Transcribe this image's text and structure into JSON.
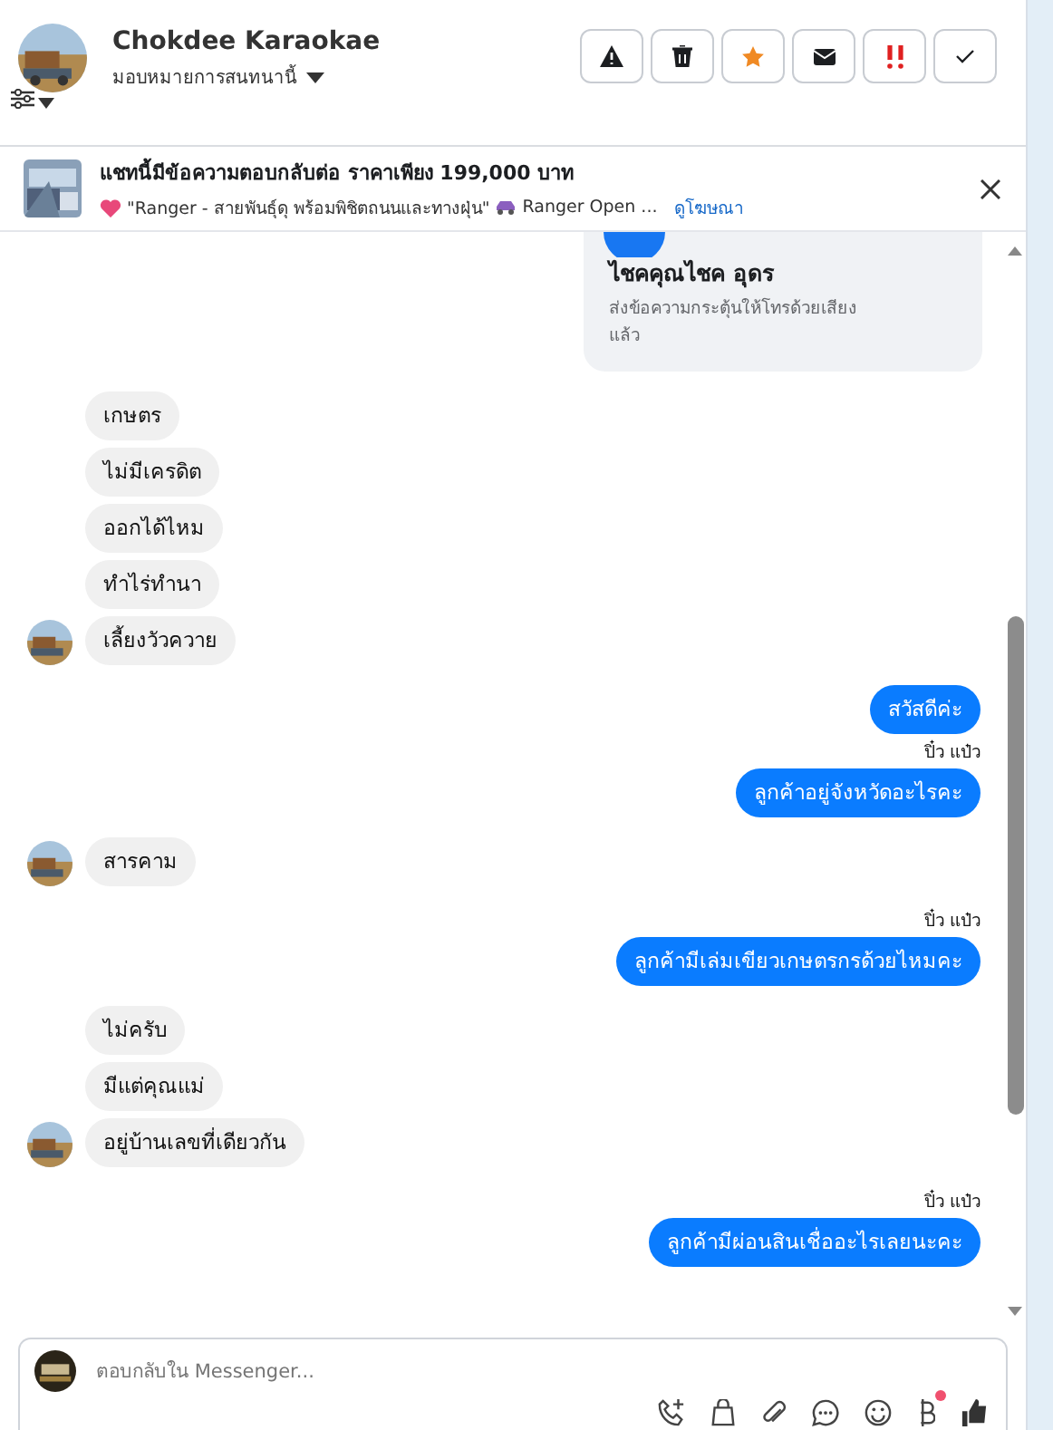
{
  "header": {
    "name": "Chokdee Karaokae",
    "assign": "มอบหมายการสนทนานี้",
    "actions": [
      {
        "kind": "alert"
      },
      {
        "kind": "trash"
      },
      {
        "kind": "star"
      },
      {
        "kind": "mail"
      },
      {
        "kind": "urgent"
      },
      {
        "kind": "check"
      }
    ]
  },
  "ad": {
    "title": "แชทนี้มีข้อความตอบกลับต่อ ราคาเพียง 199,000 บาท",
    "subtitle": "\"Ranger - สายพันธุ์ดุ พร้อมพิชิตถนนและทางฝุ่น\"",
    "subtitle2": "Ranger Open ...",
    "link": "ดูโฆษณา"
  },
  "notice": {
    "title": "ไชคคุณไชค อุดร",
    "text": "ส่งข้อความกระตุ้นให้โทรด้วยเสียงแล้ว"
  },
  "messages": [
    {
      "kind": "incoming",
      "text": "เกษตร",
      "avatar": false
    },
    {
      "kind": "incoming",
      "text": "ไม่มีเครดิต",
      "avatar": false
    },
    {
      "kind": "incoming",
      "text": "ออกได้ไหม",
      "avatar": false
    },
    {
      "kind": "incoming",
      "text": "ทำไร่ทำนา",
      "avatar": false
    },
    {
      "kind": "incoming",
      "text": "เลี้ยงวัวควาย",
      "avatar": true
    },
    {
      "kind": "outgoing",
      "text": "สวัสดีค่ะ"
    },
    {
      "kind": "sender",
      "text": "ปิ๋ว แป๋ว"
    },
    {
      "kind": "outgoing",
      "text": "ลูกค้าอยู่จังหวัดอะไรคะ"
    },
    {
      "kind": "incoming",
      "text": "สารคาม",
      "avatar": true
    },
    {
      "kind": "sender",
      "text": "ปิ๋ว แป๋ว"
    },
    {
      "kind": "outgoing",
      "text": "ลูกค้ามีเล่มเขียวเกษตรกรด้วยไหมคะ"
    },
    {
      "kind": "incoming",
      "text": "ไม่ครับ",
      "avatar": false
    },
    {
      "kind": "incoming",
      "text": "มีแต่คุณแม่",
      "avatar": false
    },
    {
      "kind": "incoming",
      "text": "อยู่บ้านเลขที่เดียวกัน",
      "avatar": true
    },
    {
      "kind": "sender",
      "text": "ปิ๋ว แป๋ว"
    },
    {
      "kind": "outgoing",
      "text": "ลูกค้ามีผ่อนสินเชื่ออะไรเลยนะคะ"
    }
  ],
  "composer": {
    "placeholder": "ตอบกลับใน Messenger...",
    "tools": [
      {
        "kind": "call"
      },
      {
        "kind": "bag"
      },
      {
        "kind": "clip"
      },
      {
        "kind": "chat"
      },
      {
        "kind": "emoji"
      },
      {
        "kind": "baht",
        "badge": true
      },
      {
        "kind": "like"
      }
    ]
  }
}
